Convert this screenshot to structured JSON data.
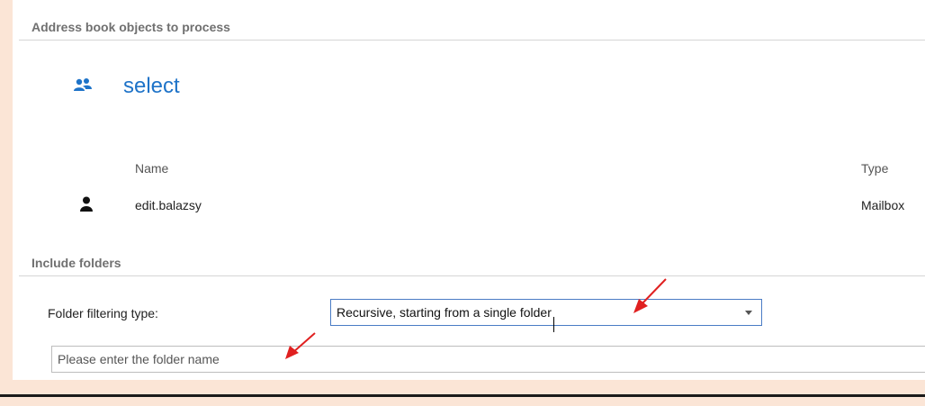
{
  "address_section": {
    "title": "Address book objects to process",
    "select_link": "select",
    "icon": "users-icon",
    "columns": {
      "name": "Name",
      "type": "Type"
    },
    "rows": [
      {
        "icon": "user-icon",
        "name": "edit.balazsy",
        "type": "Mailbox"
      }
    ]
  },
  "folders_section": {
    "title": "Include folders",
    "filter_label": "Folder filtering type:",
    "filter_value": "Recursive, starting from a single folder",
    "folder_name_placeholder": "Please enter the folder name"
  },
  "colors": {
    "page_background": "#fbe5d6",
    "link": "#1e73c8",
    "annotation_arrow": "#e02020",
    "select_border": "#4a7cc5"
  }
}
